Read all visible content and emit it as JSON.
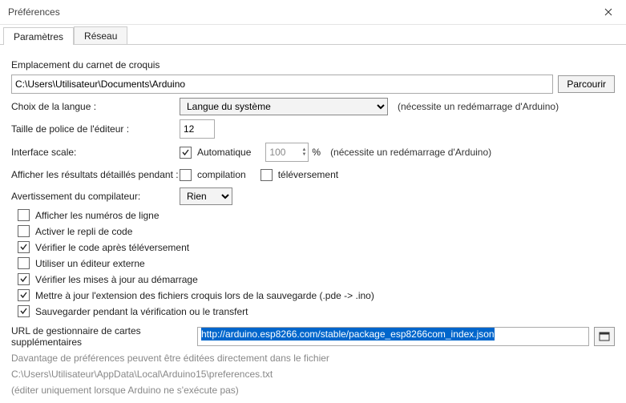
{
  "window": {
    "title": "Préférences"
  },
  "tabs": {
    "settings": "Paramètres",
    "network": "Réseau"
  },
  "sketchbook": {
    "label": "Emplacement du carnet de croquis",
    "path": "C:\\Users\\Utilisateur\\Documents\\Arduino",
    "browse": "Parcourir"
  },
  "language": {
    "label": "Choix de la langue :",
    "value": "Langue du système",
    "note": "(nécessite un redémarrage d'Arduino)"
  },
  "fontsize": {
    "label": "Taille de police de l'éditeur :",
    "value": "12"
  },
  "scale": {
    "label": "Interface scale:",
    "auto_label": "Automatique",
    "value": "100",
    "suffix": "%",
    "note": "(nécessite un redémarrage d'Arduino)"
  },
  "verbose": {
    "label": "Afficher les résultats détaillés pendant :",
    "compile": "compilation",
    "upload": "téléversement"
  },
  "warnings": {
    "label": "Avertissement du compilateur:",
    "value": "Rien"
  },
  "options": {
    "line_numbers": "Afficher les numéros de ligne",
    "code_folding": "Activer le repli de code",
    "verify_after_upload": "Vérifier le code après téléversement",
    "external_editor": "Utiliser un éditeur externe",
    "check_updates": "Vérifier les mises à jour au démarrage",
    "update_ext": "Mettre à jour  l'extension des fichiers croquis lors de la sauvegarde (.pde -> .ino)",
    "save_verify": "Sauvegarder pendant la vérification ou le transfert"
  },
  "boards_url": {
    "label": "URL de gestionnaire de cartes supplémentaires",
    "value": "http://arduino.esp8266.com/stable/package_esp8266com_index.json"
  },
  "footer": {
    "line1": "Davantage de préférences peuvent être éditées directement dans le fichier",
    "line2": "C:\\Users\\Utilisateur\\AppData\\Local\\Arduino15\\preferences.txt",
    "line3": "(éditer uniquement lorsque Arduino ne s'exécute pas)"
  }
}
